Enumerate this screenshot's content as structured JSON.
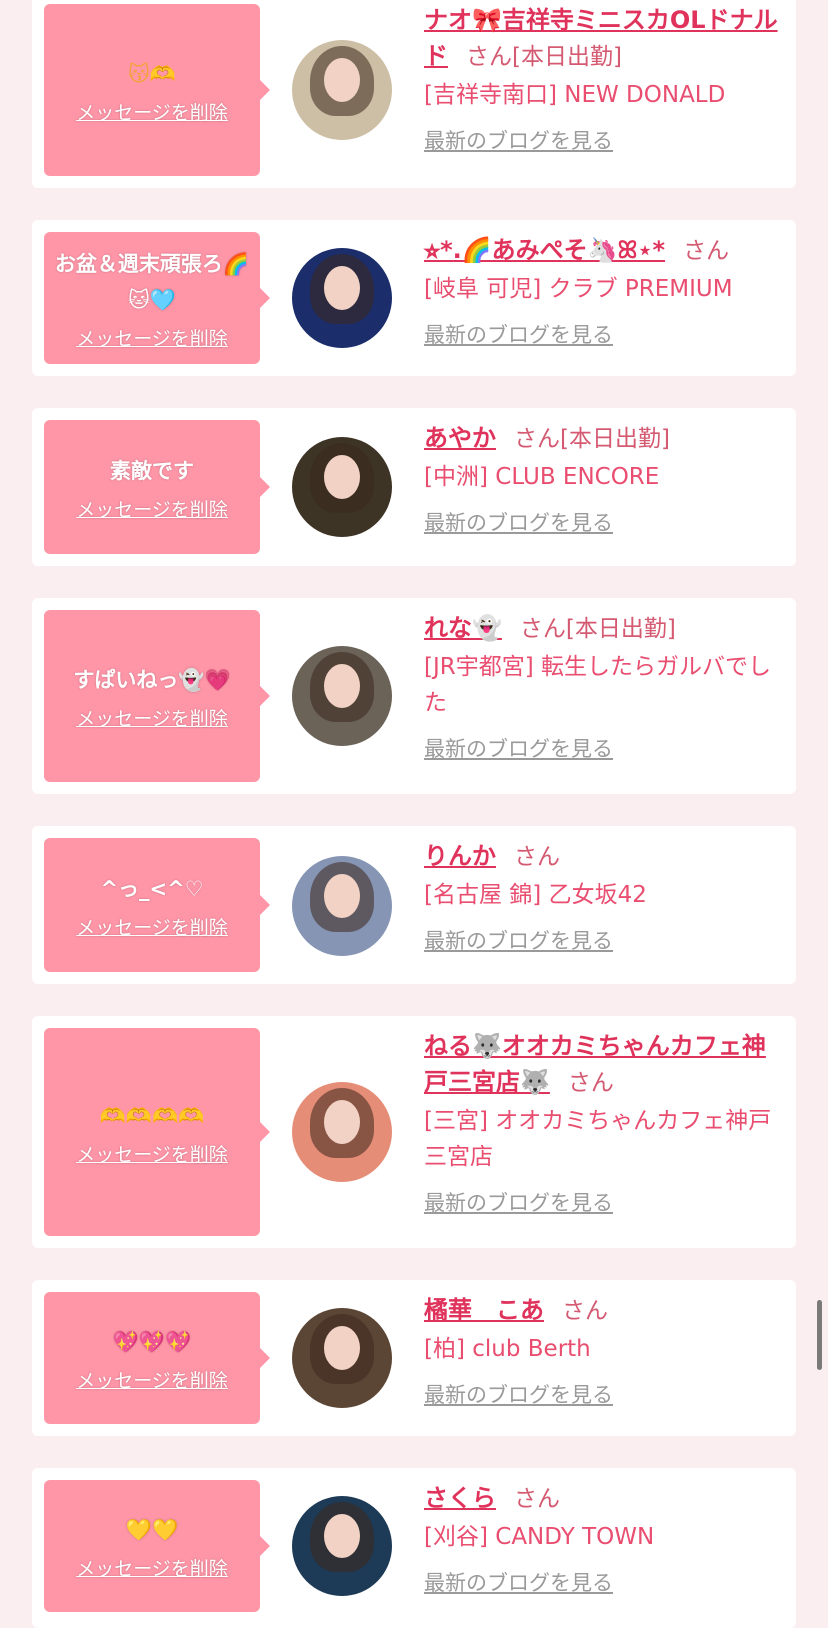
{
  "delete_label": "メッセージを削除",
  "blog_label": "最新のブログを見る",
  "san_label": "さん",
  "cards": [
    {
      "message": "😽🫶",
      "name": "ナオ🎀吉祥寺ミニスカOLドナルド",
      "suffix": "[本日出勤]",
      "shop": "[吉祥寺南口] NEW DONALD",
      "avatar_color": "#cdbfa5"
    },
    {
      "message": "お盆＆週末頑張ろ🌈🐱🩵",
      "name": "⭐︎*.🌈あみぺそ🦄ꕤ⋆*",
      "suffix": "",
      "shop": "[岐阜 可児] クラブ PREMIUM",
      "avatar_color": "#1b2d6b"
    },
    {
      "message": "素敵です",
      "name": "あやか",
      "suffix": "[本日出勤]",
      "shop": "[中洲] CLUB ENCORE",
      "avatar_color": "#3d3426"
    },
    {
      "message": "すぱいねっ👻💗",
      "name": "れな👻",
      "suffix": "[本日出勤]",
      "shop": "[JR宇都宮] 転生したらガルバでした",
      "avatar_color": "#6b6258"
    },
    {
      "message": "^っ_<^♡",
      "name": "りんか",
      "suffix": "",
      "shop": "[名古屋 錦] 乙女坂42",
      "avatar_color": "#8795b4"
    },
    {
      "message": "🫶🫶🫶🫶",
      "name": "ねる🐺オオカミちゃんカフェ神戸三宮店🐺",
      "suffix": "",
      "shop": "[三宮] オオカミちゃんカフェ神戸三宮店",
      "avatar_color": "#e58d77"
    },
    {
      "message": "💖💖💖",
      "name": "橘華　こあ",
      "suffix": "",
      "shop": "[柏] club Berth",
      "avatar_color": "#5b4535"
    },
    {
      "message": "💛💛",
      "name": "さくら",
      "suffix": "",
      "shop": "[刈谷] CANDY TOWN",
      "avatar_color": "#1d3a56"
    }
  ]
}
